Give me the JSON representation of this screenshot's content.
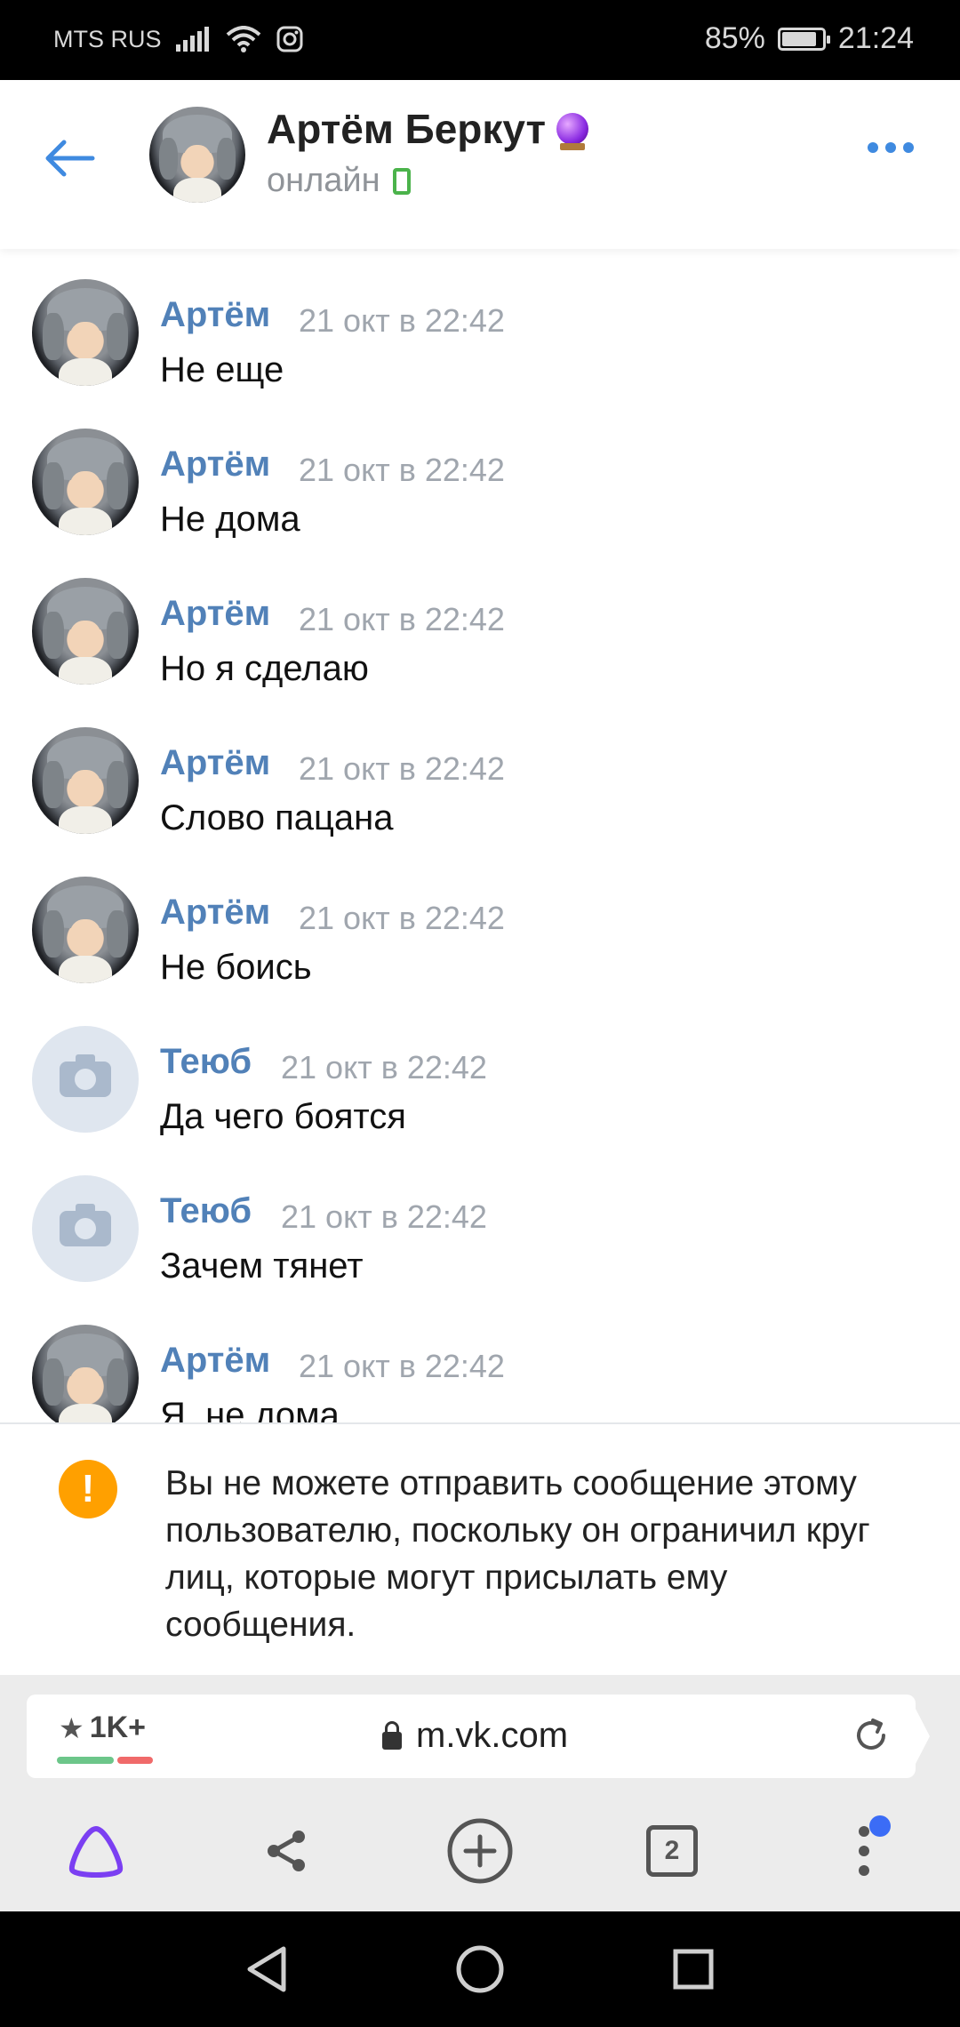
{
  "status_bar": {
    "carrier": "MTS RUS",
    "battery_percent": "85%",
    "time": "21:24",
    "icons": [
      "signal-icon",
      "wifi-icon",
      "instagram-icon",
      "battery-icon"
    ]
  },
  "header": {
    "name": "Артём Беркут",
    "status": "онлайн",
    "badge_icon": "crystal-ball-icon",
    "device_icon": "mobile-phone-icon",
    "back_icon": "arrow-left-icon",
    "menu_icon": "more-horizontal-icon"
  },
  "messages": [
    {
      "author": "Артём",
      "time": "21 окт в 22:42",
      "text": "Не еще",
      "avatar": "photo"
    },
    {
      "author": "Артём",
      "time": "21 окт в 22:42",
      "text": "Не дома",
      "avatar": "photo"
    },
    {
      "author": "Артём",
      "time": "21 окт в 22:42",
      "text": "Но я сделаю",
      "avatar": "photo"
    },
    {
      "author": "Артём",
      "time": "21 окт в 22:42",
      "text": "Слово пацана",
      "avatar": "photo"
    },
    {
      "author": "Артём",
      "time": "21 окт в 22:42",
      "text": "Не боись",
      "avatar": "photo"
    },
    {
      "author": "Теюб",
      "time": "21 окт в 22:42",
      "text": "Да чего боятся",
      "avatar": "default"
    },
    {
      "author": "Теюб",
      "time": "21 окт в 22:42",
      "text": "Зачем тянет",
      "avatar": "default"
    },
    {
      "author": "Артём",
      "time": "21 окт в 22:42",
      "text": "Я, не дома",
      "avatar": "photo"
    }
  ],
  "warning": {
    "icon": "exclamation-icon",
    "text": "Вы не можете отправить сообщение этому пользователю, поскольку он ограничил круг лиц, которые могут присылать ему сообщения."
  },
  "browser": {
    "rating": "1K+",
    "url": "m.vk.com",
    "tabs_count": "2",
    "colors": {
      "accent": "#3f8ae0",
      "author": "#5181b8",
      "warning": "#ffa000",
      "alice": "#7b3ff2"
    }
  },
  "nav": {
    "icons": [
      "back-triangle-icon",
      "home-circle-icon",
      "recents-square-icon"
    ]
  }
}
